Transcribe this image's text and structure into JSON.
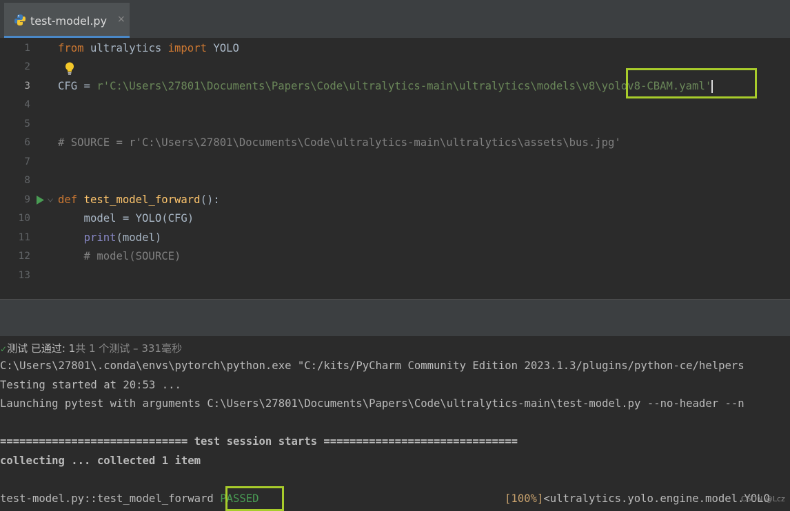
{
  "tab": {
    "filename": "test-model.py",
    "close": "×"
  },
  "editor": {
    "gutter": [
      "1",
      "2",
      "3",
      "4",
      "5",
      "6",
      "7",
      "8",
      "9",
      "10",
      "11",
      "12",
      "13"
    ],
    "line1": {
      "kw1": "from",
      "mod": " ultralytics ",
      "kw2": "import",
      "cls": " YOLO"
    },
    "line3": {
      "var": "CFG = ",
      "str": "r'C:\\Users\\27801\\Documents\\Papers\\Code\\ultralytics-main\\ultralytics\\models\\v8\\yolov8-CBAM.yaml'"
    },
    "line6": "# SOURCE = r'C:\\Users\\27801\\Documents\\Code\\ultralytics-main\\ultralytics\\assets\\bus.jpg'",
    "line9": {
      "kw": "def",
      "fn": "test_model_forward",
      "rest": "():"
    },
    "line10": "    model = YOLO(CFG)",
    "line11": {
      "indent": "    ",
      "bi": "print",
      "rest": "(model)"
    },
    "line12": "    # model(SOURCE)"
  },
  "run": {
    "status_pass": "测试 已通过: 1",
    "status_detail": "共 1 个测试 – 331毫秒",
    "lines": {
      "l1": "C:\\Users\\27801\\.conda\\envs\\pytorch\\python.exe \"C:/kits/PyCharm Community Edition 2023.1.3/plugins/python-ce/helpers",
      "l2": "Testing started at 20:53 ...",
      "l3": "Launching pytest with arguments C:\\Users\\27801\\Documents\\Papers\\Code\\ultralytics-main\\test-model.py --no-header --n",
      "l4": "============================= test session starts ==============================",
      "l5": "collecting ... collected 1 item",
      "l6_prefix": "test-model.py::test_model_forward ",
      "l6_status": "PASSED",
      "l6_pct": "[100%]",
      "l6_rest": "<ultralytics.yolo.engine.model.YOLO"
    },
    "watermark": "CSDN @Lcz"
  },
  "colors": {
    "highlight_box": "#a8cc2b",
    "passed": "#499c54"
  }
}
